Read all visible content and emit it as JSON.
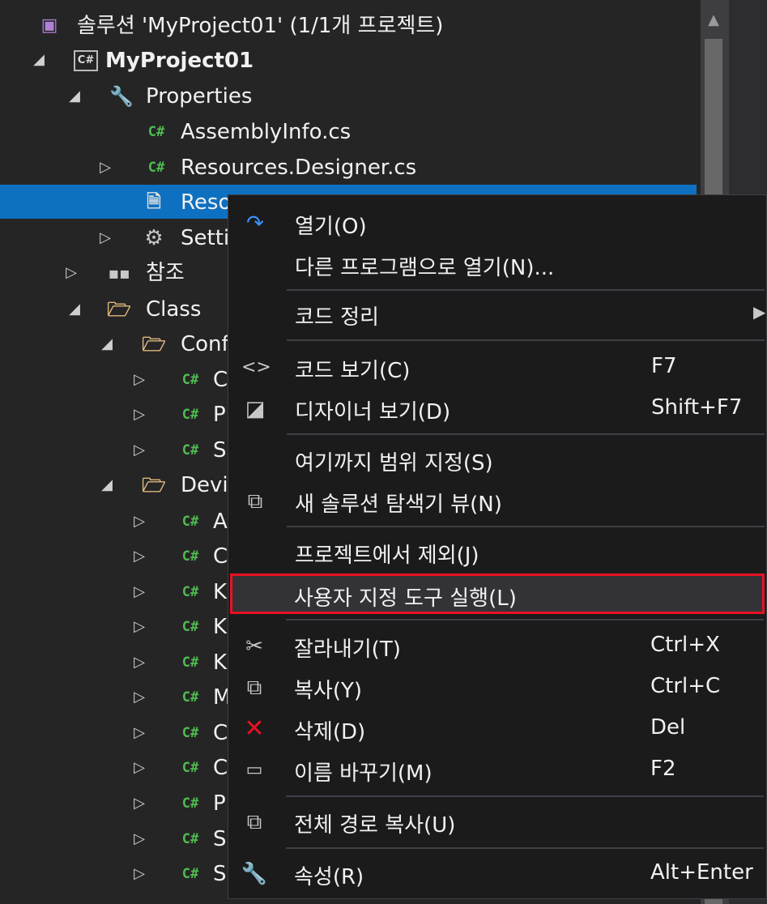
{
  "solution_explorer": {
    "solution_label": "솔루션 'MyProject01' (1/1개 프로젝트)",
    "project_name": "MyProject01",
    "items": {
      "properties": "Properties",
      "assemblyinfo": "AssemblyInfo.cs",
      "resources_designer": "Resources.Designer.cs",
      "resources_resx": "Reso",
      "settings": "Setti",
      "references": "참조",
      "class_folder": "Class",
      "config_folder": "Conf",
      "config_c1": "C",
      "config_c2": "P",
      "config_c3": "S",
      "device_folder": "Devi",
      "dev_1": "A",
      "dev_2": "C",
      "dev_3": "K",
      "dev_4": "K",
      "dev_5": "K",
      "dev_6": "M",
      "dev_7": "C",
      "dev_8": "C",
      "dev_9": "P",
      "dev_10": "S",
      "dev_11": "S"
    },
    "csharp_badge": "C#"
  },
  "context_menu": {
    "open": "열기(O)",
    "open_with": "다른 프로그램으로 열기(N)...",
    "cleanup_code": "코드 정리",
    "view_code": "코드 보기(C)",
    "view_code_shortcut": "F7",
    "view_designer": "디자이너 보기(D)",
    "view_designer_shortcut": "Shift+F7",
    "scope_to_this": "여기까지 범위 지정(S)",
    "new_explorer_view": "새 솔루션 탐색기 뷰(N)",
    "exclude_from_project": "프로젝트에서 제외(J)",
    "run_custom_tool": "사용자 지정 도구 실행(L)",
    "cut": "잘라내기(T)",
    "cut_shortcut": "Ctrl+X",
    "copy": "복사(Y)",
    "copy_shortcut": "Ctrl+C",
    "delete": "삭제(D)",
    "delete_shortcut": "Del",
    "rename": "이름 바꾸기(M)",
    "rename_shortcut": "F2",
    "copy_full_path": "전체 경로 복사(U)",
    "properties": "속성(R)",
    "properties_shortcut": "Alt+Enter"
  },
  "colors": {
    "selection": "#0e70c0",
    "highlight_border": "#e81123",
    "csharp_icon": "#4fbc4f",
    "folder_icon": "#dcb67a"
  }
}
